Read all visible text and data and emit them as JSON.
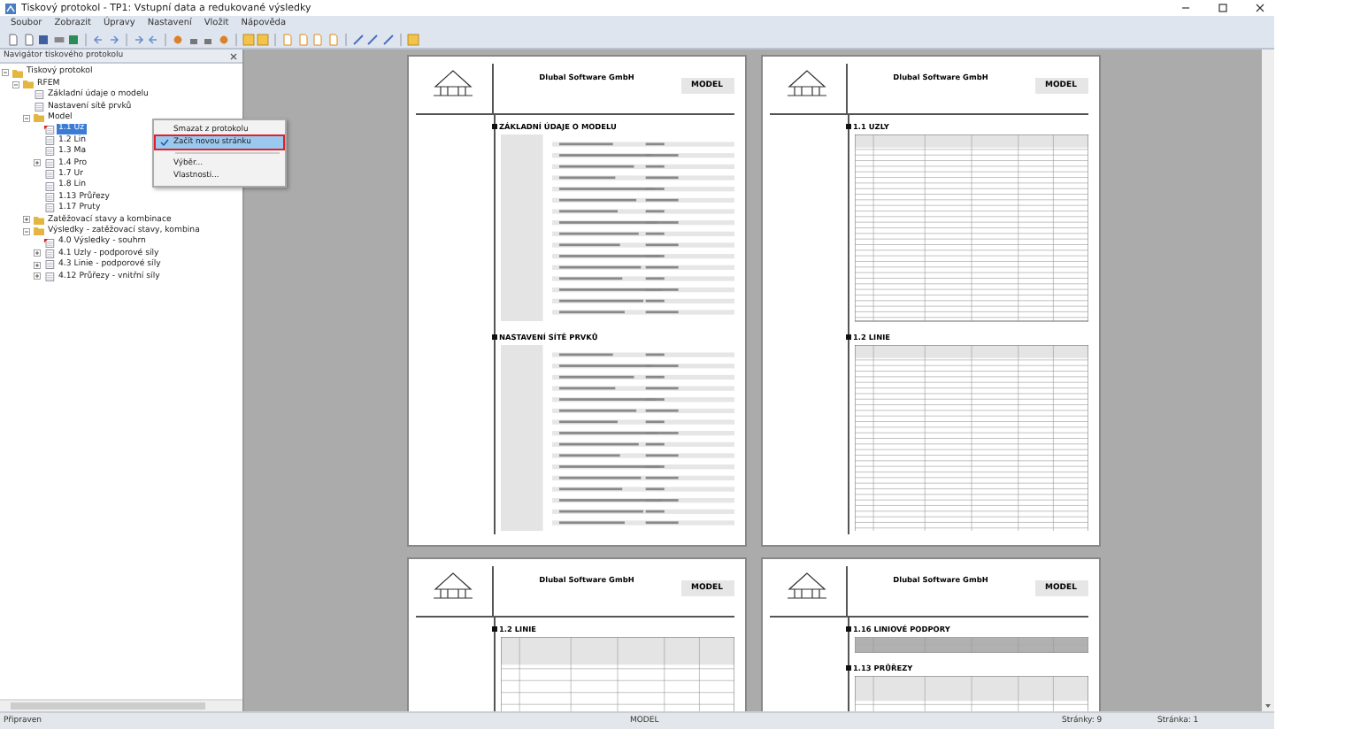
{
  "window": {
    "title": "Tiskový protokol - TP1: Vstupní data a redukované výsledky"
  },
  "menu": [
    "Soubor",
    "Zobrazit",
    "Úpravy",
    "Nastavení",
    "Vložit",
    "Nápověda"
  ],
  "navigator": {
    "title": "Navigátor tiskového protokolu",
    "tree": [
      {
        "label": "Tiskový protokol",
        "kind": "folder",
        "expanded": true,
        "children": [
          {
            "label": "RFEM",
            "kind": "folder",
            "expanded": true,
            "children": [
              {
                "label": "Základní údaje o modelu",
                "kind": "page"
              },
              {
                "label": "Nastavení sítě prvků",
                "kind": "page"
              },
              {
                "label": "Model",
                "kind": "folder",
                "expanded": true,
                "children": [
                  {
                    "label": "1.1 Uz",
                    "kind": "page",
                    "selected": true,
                    "new_page": true
                  },
                  {
                    "label": "1.2 Lin",
                    "kind": "page",
                    "selected": false
                  },
                  {
                    "label": "1.3 Ma",
                    "kind": "page",
                    "selected": false
                  },
                  {
                    "label": "1.4 Pro",
                    "kind": "page",
                    "selected": false,
                    "expanded": false
                  },
                  {
                    "label": "1.7 Ur",
                    "kind": "page",
                    "selected": false
                  },
                  {
                    "label": "1.8 Lin",
                    "kind": "page",
                    "selected": false
                  },
                  {
                    "label": "1.13 Průřezy",
                    "kind": "page",
                    "selected": false
                  },
                  {
                    "label": "1.17 Pruty",
                    "kind": "page",
                    "selected": false
                  }
                ]
              },
              {
                "label": "Zatěžovací stavy a kombinace",
                "kind": "folder",
                "expanded": false
              },
              {
                "label": "Výsledky - zatěžovací stavy, kombina",
                "kind": "folder",
                "expanded": true,
                "children": [
                  {
                    "label": "4.0 Výsledky - souhrn",
                    "kind": "page",
                    "new_page": true
                  },
                  {
                    "label": "4.1 Uzly - podporové síly",
                    "kind": "page",
                    "expanded": false
                  },
                  {
                    "label": "4.3 Linie - podporové síly",
                    "kind": "page",
                    "expanded": false
                  },
                  {
                    "label": "4.12 Průřezy - vnitřní síly",
                    "kind": "page",
                    "expanded": false
                  }
                ]
              }
            ]
          }
        ]
      }
    ]
  },
  "context_menu": [
    {
      "label": "Smazat z protokolu",
      "checked": false,
      "highlighted": false
    },
    {
      "label": "Začít novou stránku",
      "checked": true,
      "highlighted": true
    },
    {
      "label": "Výběr...",
      "checked": false,
      "highlighted": false,
      "separator_before": true
    },
    {
      "label": "Vlastnosti...",
      "checked": false,
      "highlighted": false
    }
  ],
  "pages": [
    {
      "company": "Dlubal Software GmbH",
      "badge": "MODEL",
      "sections": [
        {
          "title": "ZÁKLADNÍ ÚDAJE O MODELU",
          "kind": "form"
        },
        {
          "title": "NASTAVENÍ SÍTĚ PRVKŮ",
          "kind": "form"
        }
      ]
    },
    {
      "company": "Dlubal Software GmbH",
      "badge": "MODEL",
      "sections": [
        {
          "title": "1.1 UZLY",
          "kind": "table"
        },
        {
          "title": "1.2 LINIE",
          "kind": "table"
        }
      ]
    },
    {
      "company": "Dlubal Software GmbH",
      "badge": "MODEL",
      "sections": [
        {
          "title": "1.2 LINIE",
          "kind": "table"
        }
      ]
    },
    {
      "company": "Dlubal Software GmbH",
      "badge": "MODEL",
      "sections": [
        {
          "title": "1.16 LINIOVÉ PODPORY",
          "kind": "short_table"
        },
        {
          "title": "1.13 PRŮŘEZY",
          "kind": "table"
        }
      ]
    }
  ],
  "status_bar": {
    "state": "Připraven",
    "model": "MODEL",
    "pages": "Stránky: 9",
    "page": "Stránka: 1"
  }
}
